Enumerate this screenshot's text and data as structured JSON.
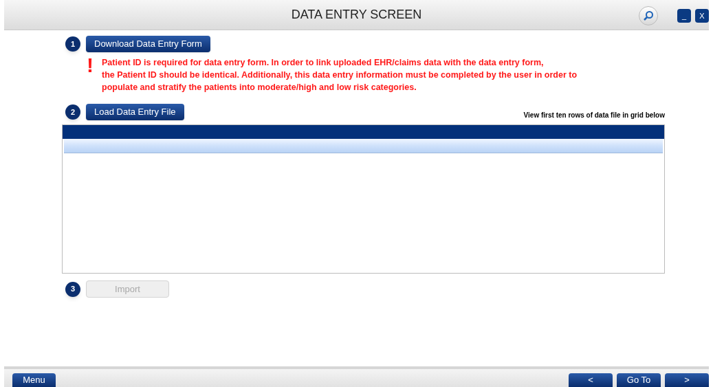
{
  "window": {
    "title": "DATA ENTRY SCREEN",
    "controls": [
      "_",
      "X"
    ]
  },
  "steps": [
    {
      "number": "1",
      "label": "Download Data Entry Form",
      "disabled": false
    },
    {
      "number": "2",
      "label": "Load Data Entry File",
      "disabled": false
    },
    {
      "number": "3",
      "label": "Import",
      "disabled": true
    }
  ],
  "warning": {
    "mark": "!",
    "text": "Patient ID is required for data entry form. In order to link uploaded EHR/claims data with the data entry form,\nthe Patient ID should be identical. Additionally, this data entry information must be completed by the user in order to\npopulate and stratify the patients into moderate/high and low risk categories."
  },
  "grid_note": "View first ten rows of data file in grid below",
  "footer": {
    "menu": "Menu",
    "nav": [
      "<",
      "Go To",
      ">"
    ]
  }
}
